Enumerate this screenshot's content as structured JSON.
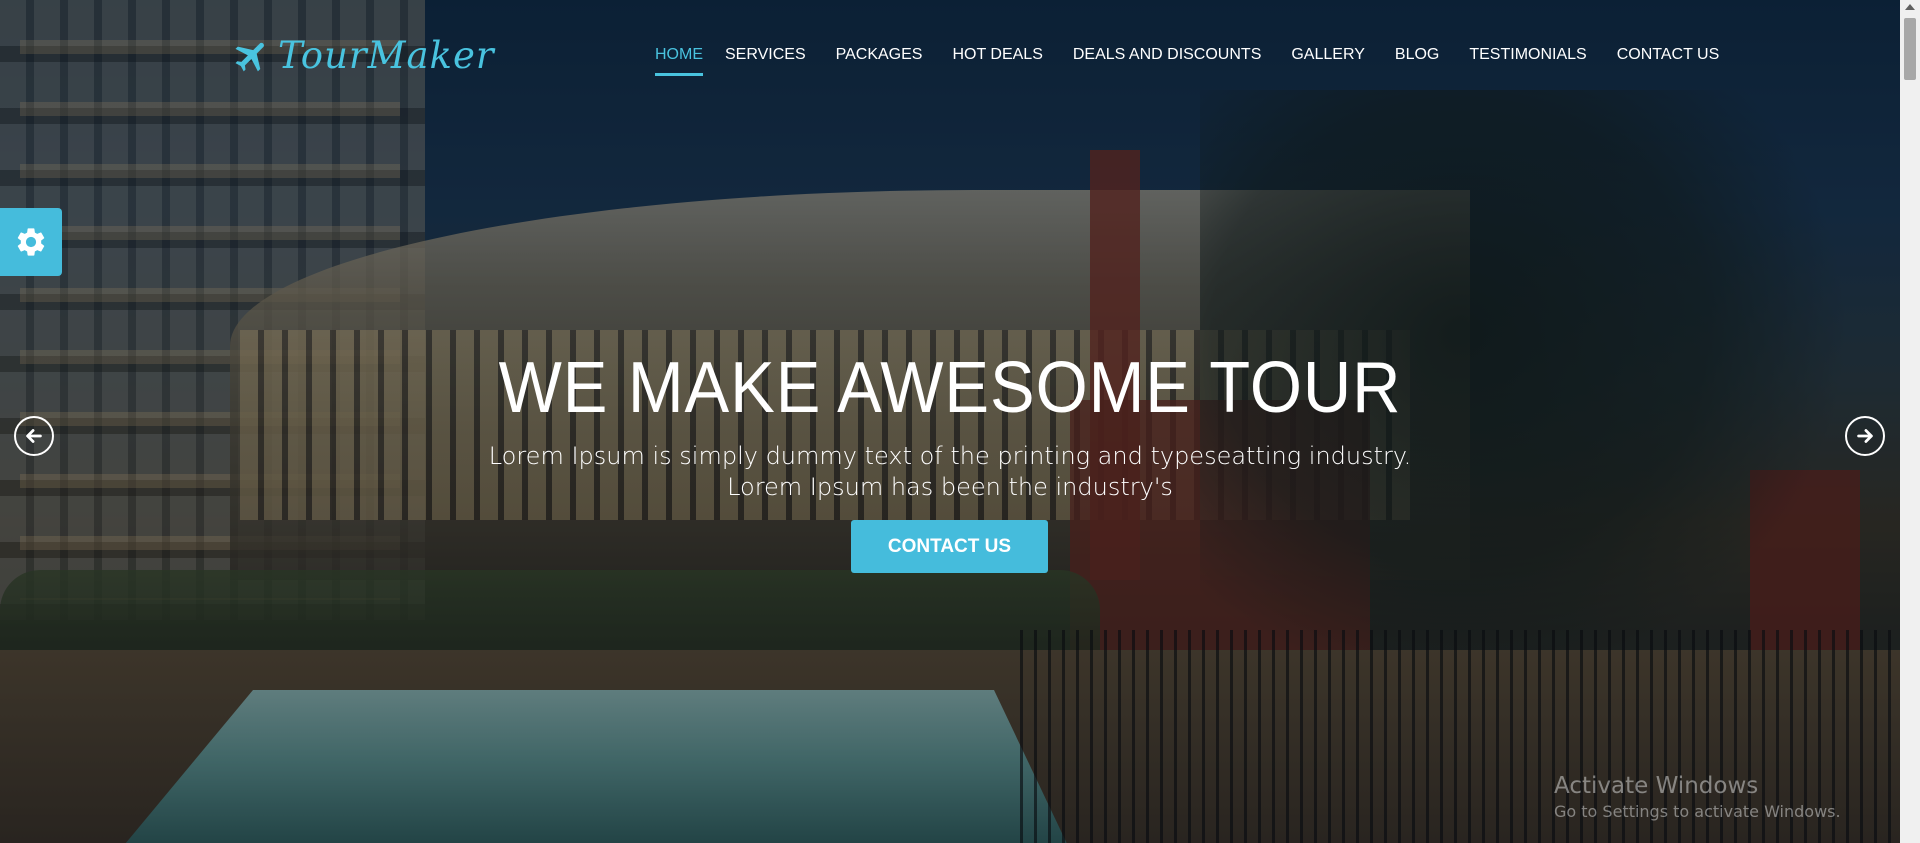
{
  "brand": {
    "name": "TourMaker",
    "icon": "airplane-icon",
    "accent": "#49c3df"
  },
  "nav": {
    "items": [
      {
        "label": "HOME",
        "active": true
      },
      {
        "label": "SERVICES"
      },
      {
        "label": "PACKAGES"
      },
      {
        "label": "HOT DEALS"
      },
      {
        "label": "DEALS AND DISCOUNTS"
      },
      {
        "label": "GALLERY"
      },
      {
        "label": "BLOG"
      },
      {
        "label": "TESTIMONIALS"
      },
      {
        "label": "CONTACT US"
      }
    ]
  },
  "settings": {
    "icon": "gear-icon"
  },
  "slider": {
    "prev_icon": "arrow-left-icon",
    "next_icon": "arrow-right-icon"
  },
  "hero": {
    "title": "WE MAKE AWESOME TOUR",
    "text": "Lorem Ipsum is simply dummy text of the printing and typeseatting industry. Lorem Ipsum has been the industry's",
    "button": "CONTACT US"
  },
  "watermark": {
    "title": "Activate Windows",
    "subtitle": "Go to Settings to activate Windows."
  },
  "colors": {
    "button_bg": "#45bcdc",
    "nav_text": "#ffffff"
  }
}
